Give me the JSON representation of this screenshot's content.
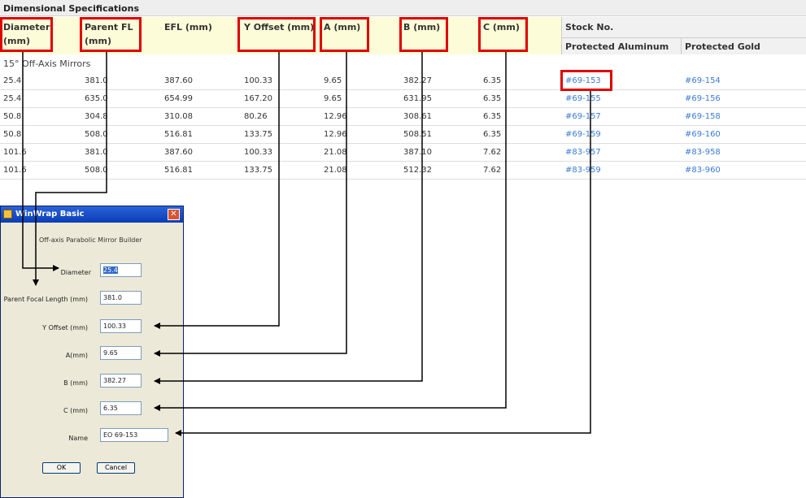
{
  "table": {
    "title": "Dimensional Specifications",
    "headers": {
      "diameter": [
        "Diameter",
        "(mm)"
      ],
      "parent_fl": [
        "Parent FL",
        "(mm)"
      ],
      "efl": "EFL (mm)",
      "y_offset": "Y Offset (mm)",
      "a": "A (mm)",
      "b": "B (mm)",
      "c": "C (mm)",
      "stock_no": "Stock No.",
      "protected_aluminum": "Protected Aluminum",
      "protected_gold": "Protected Gold"
    },
    "section": "15° Off-Axis Mirrors",
    "rows": [
      {
        "dia": "25.4",
        "pfl": "381.0",
        "efl": "387.60",
        "yoff": "100.33",
        "a": "9.65",
        "b": "382.27",
        "c": "6.35",
        "al": "#69-153",
        "au": "#69-154"
      },
      {
        "dia": "25.4",
        "pfl": "635.0",
        "efl": "654.99",
        "yoff": "167.20",
        "a": "9.65",
        "b": "631.95",
        "c": "6.35",
        "al": "#69-155",
        "au": "#69-156"
      },
      {
        "dia": "50.8",
        "pfl": "304.8",
        "efl": "310.08",
        "yoff": "80.26",
        "a": "12.96",
        "b": "308.61",
        "c": "6.35",
        "al": "#69-157",
        "au": "#69-158"
      },
      {
        "dia": "50.8",
        "pfl": "508.0",
        "efl": "516.81",
        "yoff": "133.75",
        "a": "12.96",
        "b": "508.51",
        "c": "6.35",
        "al": "#69-159",
        "au": "#69-160"
      },
      {
        "dia": "101.6",
        "pfl": "381.0",
        "efl": "387.60",
        "yoff": "100.33",
        "a": "21.08",
        "b": "387.10",
        "c": "7.62",
        "al": "#83-957",
        "au": "#83-958"
      },
      {
        "dia": "101.6",
        "pfl": "508.0",
        "efl": "516.81",
        "yoff": "133.75",
        "a": "21.08",
        "b": "512.32",
        "c": "7.62",
        "al": "#83-959",
        "au": "#83-960"
      }
    ]
  },
  "dialog": {
    "title": "WinWrap Basic",
    "close_glyph": "✕",
    "subtitle": "Off-axis Parabolic Mirror Builder",
    "labels": {
      "diameter": "Diameter",
      "parent_focal_length": "Parent Focal Length (mm)",
      "y_offset": "Y Offset (mm)",
      "a": "A(mm)",
      "b": "B (mm)",
      "c": "C (mm)",
      "name": "Name"
    },
    "values": {
      "diameter": "25.4",
      "parent_focal_length": "381.0",
      "y_offset": "100.33",
      "a": "9.65",
      "b": "382.27",
      "c": "6.35",
      "name": "EO 69-153"
    },
    "ok_label": "OK",
    "cancel_label": "Cancel"
  },
  "colors": {
    "highlight_box": "#e00000",
    "link": "#3a7bd5",
    "header_bg": "#fcfcd8",
    "dialog_title": "#0a3db6"
  }
}
